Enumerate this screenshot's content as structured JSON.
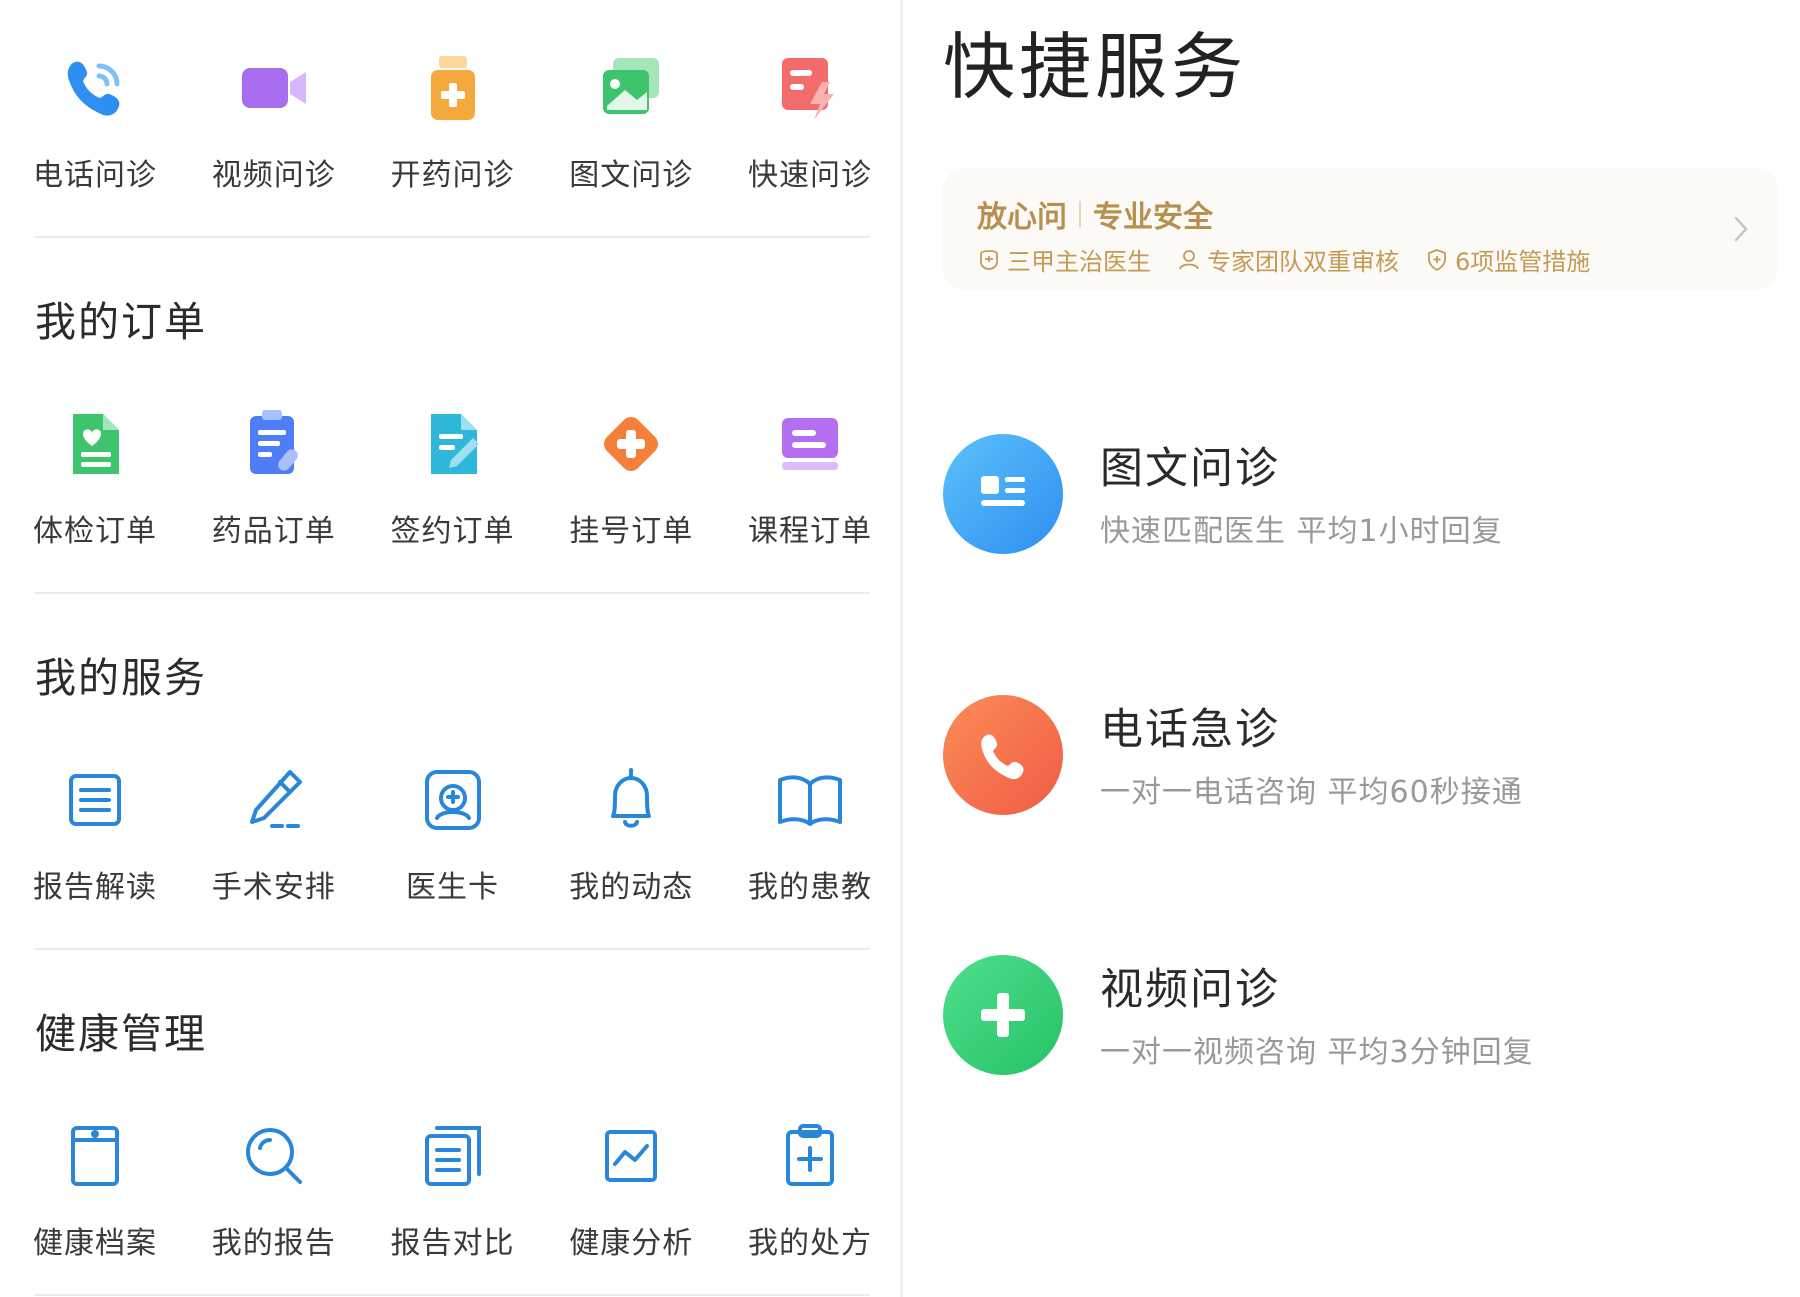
{
  "top_services": [
    {
      "label": "电话问诊",
      "icon": "phone-call-icon"
    },
    {
      "label": "视频问诊",
      "icon": "video-camera-icon"
    },
    {
      "label": "开药问诊",
      "icon": "medicine-bottle-icon"
    },
    {
      "label": "图文问诊",
      "icon": "image-chat-icon"
    },
    {
      "label": "快速问诊",
      "icon": "fast-consult-icon"
    }
  ],
  "orders": {
    "title": "我的订单",
    "items": [
      {
        "label": "体检订单",
        "icon": "checkup-document-icon"
      },
      {
        "label": "药品订单",
        "icon": "medicine-clipboard-icon"
      },
      {
        "label": "签约订单",
        "icon": "contract-document-icon"
      },
      {
        "label": "挂号订单",
        "icon": "registration-cross-icon"
      },
      {
        "label": "课程订单",
        "icon": "course-book-icon"
      }
    ]
  },
  "my_services": {
    "title": "我的服务",
    "items": [
      {
        "label": "报告解读",
        "icon": "report-list-icon"
      },
      {
        "label": "手术安排",
        "icon": "scalpel-icon"
      },
      {
        "label": "医生卡",
        "icon": "doctor-card-icon"
      },
      {
        "label": "我的动态",
        "icon": "bell-icon"
      },
      {
        "label": "我的患教",
        "icon": "open-book-icon"
      }
    ]
  },
  "health": {
    "title": "健康管理",
    "items": [
      {
        "label": "健康档案",
        "icon": "health-file-icon"
      },
      {
        "label": "我的报告",
        "icon": "search-report-icon"
      },
      {
        "label": "报告对比",
        "icon": "compare-documents-icon"
      },
      {
        "label": "健康分析",
        "icon": "trend-chart-icon"
      },
      {
        "label": "我的处方",
        "icon": "prescription-clipboard-icon"
      }
    ]
  },
  "quick": {
    "title": "快捷服务",
    "banner": {
      "brand": "放心问",
      "slogan": "专业安全",
      "features": [
        "三甲主治医生",
        "专家团队双重审核",
        "6项监管措施"
      ]
    },
    "services": [
      {
        "title": "图文问诊",
        "subtitle": "快速匹配医生 平均1小时回复",
        "color": "#3aa5f3"
      },
      {
        "title": "电话急诊",
        "subtitle": "一对一电话咨询 平均60秒接通",
        "color": "#f5714a"
      },
      {
        "title": "视频问诊",
        "subtitle": "一对一视频咨询 平均3分钟回复",
        "color": "#35cf78"
      }
    ]
  },
  "colors": {
    "blue": "#2f8ff0",
    "blue_line": "#2a86d8",
    "gold": "#b8904e"
  }
}
